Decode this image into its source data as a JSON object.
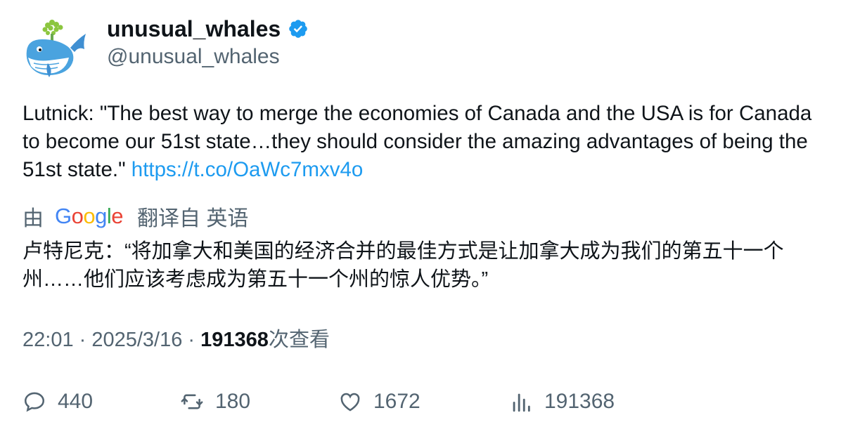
{
  "author": {
    "name": "unusual_whales",
    "handle": "@unusual_whales",
    "verified": true,
    "avatar_icon": "whale-icon"
  },
  "tweet": {
    "text": "Lutnick: \"The best way to merge the economies of Canada and the USA is for Canada to become our 51st state…they should consider the amazing advantages of being the 51st state.\" ",
    "link": "https://t.co/OaWc7mxv4o"
  },
  "translation": {
    "by_label": "由",
    "provider": "Google",
    "from_label": "翻译自 英语",
    "text": "卢特尼克：“将加拿大和美国的经济合并的最佳方式是让加拿大成为我们的第五十一个州……他们应该考虑成为第五十一个州的惊人优势。”"
  },
  "meta": {
    "time": "22:01",
    "separator": " · ",
    "date": "2025/3/16",
    "views": "191368",
    "views_label": "次查看"
  },
  "actions": {
    "replies": "440",
    "retweets": "180",
    "likes": "1672",
    "views": "191368"
  },
  "colors": {
    "accent": "#1d9bf0",
    "secondary_text": "#536471",
    "primary_text": "#0f1419"
  }
}
